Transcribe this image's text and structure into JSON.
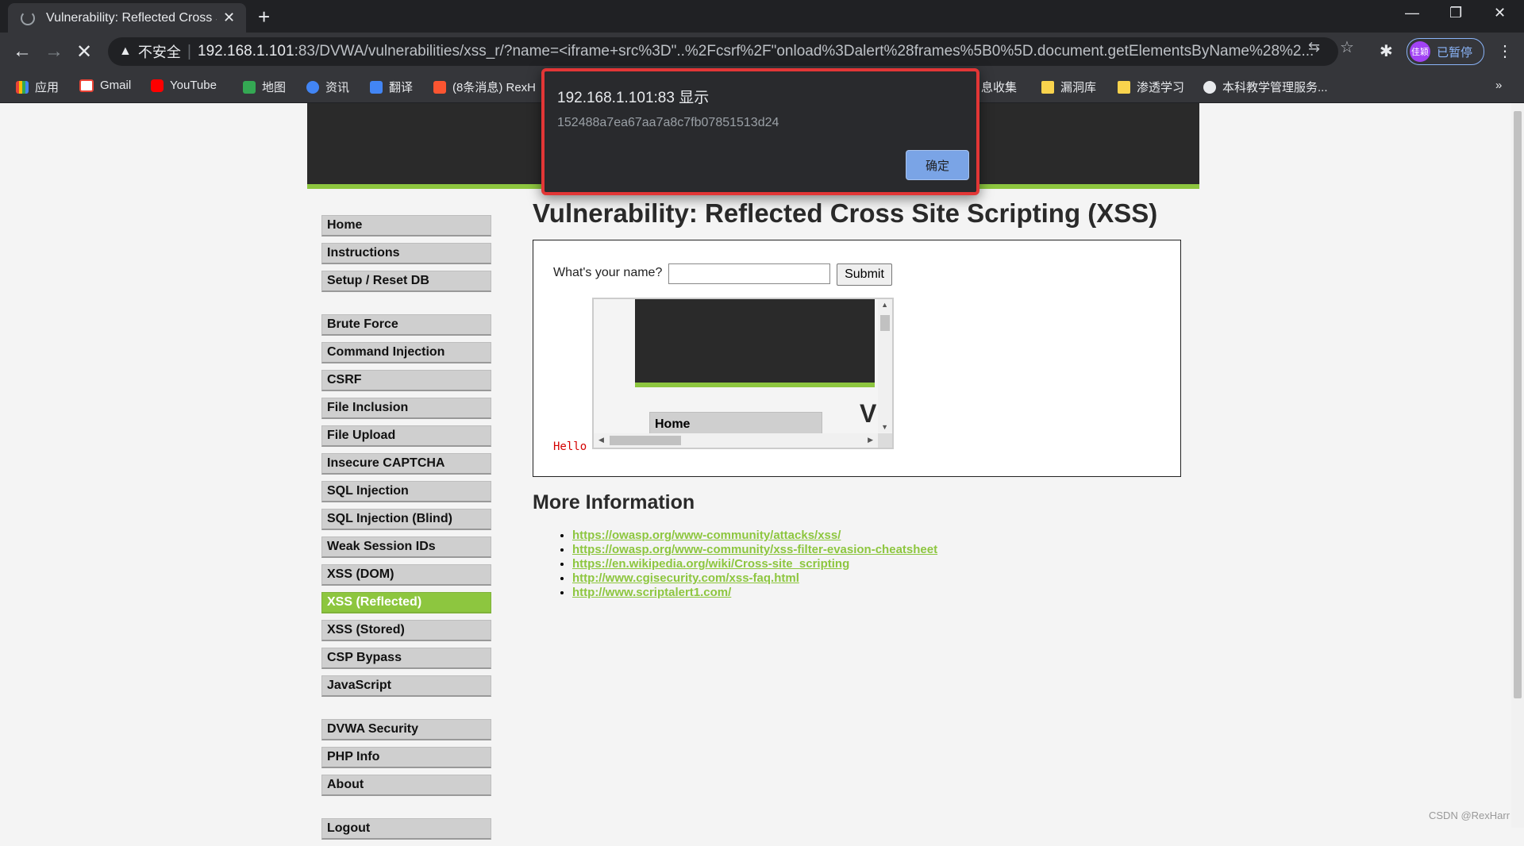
{
  "browser": {
    "tab_title": "Vulnerability: Reflected Cross Site Scripting (XSS)",
    "insecure_label": "不安全",
    "url_host": "192.168.1.101",
    "url_rest": ":83/DVWA/vulnerabilities/xss_r/?name=<iframe+src%3D\"..%2Fcsrf%2F\"onload%3Dalert%28frames%5B0%5D.document.getElementsByName%28%2...",
    "profile_initials": "佳颖",
    "profile_label": "已暂停",
    "bookmarks": [
      "应用",
      "Gmail",
      "YouTube",
      "地图",
      "资讯",
      "翻译",
      "(8条消息) RexH",
      "息收集",
      "漏洞库",
      "渗透学习",
      "本科教学管理服务..."
    ]
  },
  "page": {
    "title": "Vulnerability: Reflected Cross Site Scripting (XSS)",
    "menu_group1": [
      "Home",
      "Instructions",
      "Setup / Reset DB"
    ],
    "menu_group2": [
      "Brute Force",
      "Command Injection",
      "CSRF",
      "File Inclusion",
      "File Upload",
      "Insecure CAPTCHA",
      "SQL Injection",
      "SQL Injection (Blind)",
      "Weak Session IDs",
      "XSS (DOM)",
      "XSS (Reflected)",
      "XSS (Stored)",
      "CSP Bypass",
      "JavaScript"
    ],
    "menu_group3": [
      "DVWA Security",
      "PHP Info",
      "About"
    ],
    "menu_group4": [
      "Logout"
    ],
    "form_label": "What's your name?",
    "name_value": "",
    "submit_label": "Submit",
    "iframe_home": "Home",
    "iframe_v": "V",
    "hello": "Hello",
    "more_info_title": "More Information",
    "links": [
      "https://owasp.org/www-community/attacks/xss/",
      "https://owasp.org/www-community/xss-filter-evasion-cheatsheet",
      "https://en.wikipedia.org/wiki/Cross-site_scripting",
      "http://www.cgisecurity.com/xss-faq.html",
      "http://www.scriptalert1.com/"
    ]
  },
  "alert": {
    "title": "192.168.1.101:83 显示",
    "message": "152488a7ea67aa7a8c7fb07851513d24",
    "ok_label": "确定"
  },
  "watermark": "CSDN @RexHarr",
  "colors": {
    "accent": "#8dc63f",
    "header": "#2a2a2a",
    "alert_border": "#e23636"
  }
}
